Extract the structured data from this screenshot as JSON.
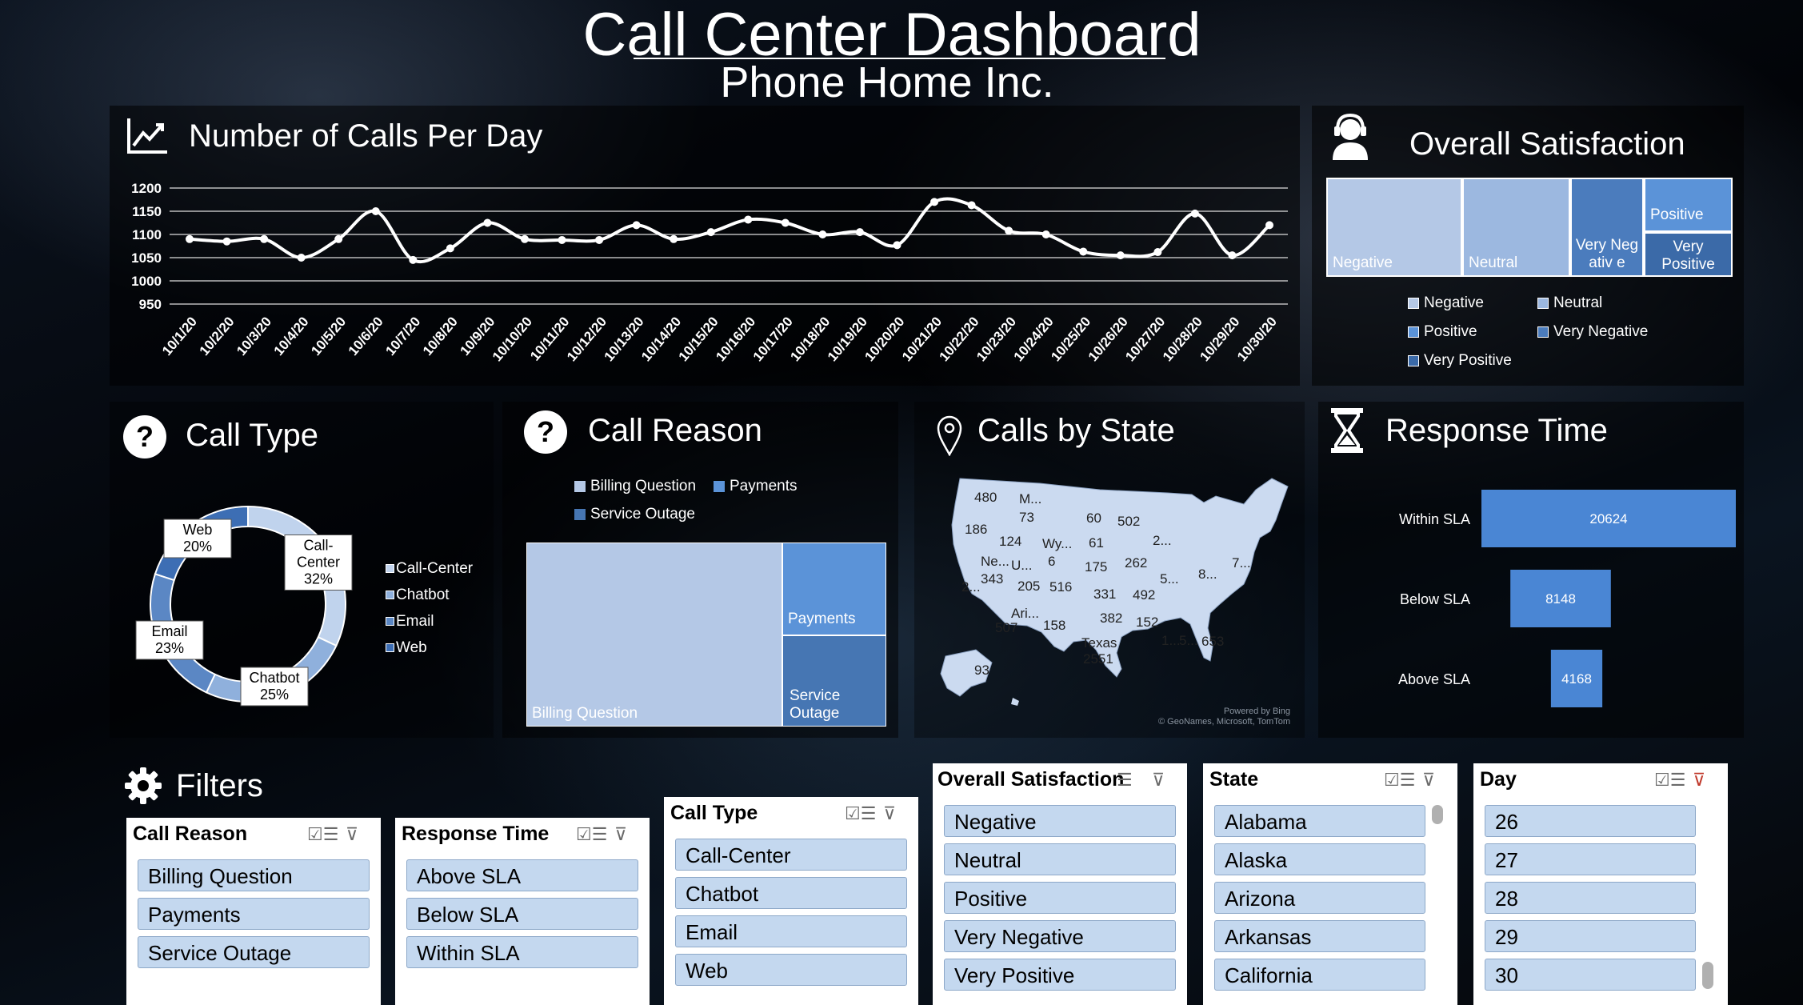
{
  "header": {
    "title": "Call Center Dashboard",
    "subtitle": "Phone Home Inc."
  },
  "calls_per_day": {
    "title": "Number of Calls Per Day",
    "icon": "line-chart-icon",
    "chart_data": {
      "type": "line",
      "yticks": [
        1200,
        1150,
        1100,
        1050,
        1000,
        950
      ],
      "ylim": [
        950,
        1200
      ],
      "grid": true,
      "x": [
        "10/1/20",
        "10/2/20",
        "10/3/20",
        "10/4/20",
        "10/5/20",
        "10/6/20",
        "10/7/20",
        "10/8/20",
        "10/9/20",
        "10/10/20",
        "10/11/20",
        "10/12/20",
        "10/13/20",
        "10/14/20",
        "10/15/20",
        "10/16/20",
        "10/17/20",
        "10/18/20",
        "10/19/20",
        "10/20/20",
        "10/21/20",
        "10/22/20",
        "10/23/20",
        "10/24/20",
        "10/25/20",
        "10/26/20",
        "10/27/20",
        "10/28/20",
        "10/29/20",
        "10/30/20"
      ],
      "values": [
        1090,
        1085,
        1090,
        1050,
        1090,
        1150,
        1045,
        1070,
        1125,
        1090,
        1088,
        1088,
        1120,
        1090,
        1105,
        1132,
        1125,
        1100,
        1105,
        1077,
        1170,
        1163,
        1108,
        1100,
        1063,
        1055,
        1062,
        1145,
        1055,
        1120
      ]
    }
  },
  "satisfaction": {
    "title": "Overall Satisfaction",
    "icon": "support-agent-icon",
    "chart_data": {
      "type": "treemap",
      "items": [
        {
          "label": "Negative",
          "color": "#b4c8e6"
        },
        {
          "label": "Neutral",
          "color": "#9cb8e0"
        },
        {
          "label": "Very Negativ e",
          "color": "#4b7cbd"
        },
        {
          "label": "Positive",
          "color": "#5b93d8"
        },
        {
          "label": "Very Positive",
          "color": "#3b6aa8"
        }
      ],
      "legend": [
        "Negative",
        "Neutral",
        "Positive",
        "Very Negative",
        "Very Positive"
      ]
    }
  },
  "call_type": {
    "title": "Call Type",
    "icon": "question-icon",
    "chart_data": {
      "type": "pie",
      "donut": true,
      "slices": [
        {
          "label": "Call-Center",
          "value": 32,
          "text": "Call-Center 32%",
          "color": "#c0d3ed"
        },
        {
          "label": "Chatbot",
          "value": 25,
          "text": "Chatbot 25%",
          "color": "#8fb0dc"
        },
        {
          "label": "Email",
          "value": 23,
          "text": "Email 23%",
          "color": "#5b87c4"
        },
        {
          "label": "Web",
          "value": 20,
          "text": "Web 20%",
          "color": "#3d6eb4"
        }
      ],
      "legend": [
        "Call-Center",
        "Chatbot",
        "Email",
        "Web"
      ]
    }
  },
  "call_reason": {
    "title": "Call Reason",
    "icon": "question-icon",
    "chart_data": {
      "type": "treemap",
      "legend": [
        "Billing Question",
        "Payments",
        "Service Outage"
      ],
      "items": [
        {
          "label": "Billing Question",
          "color": "#b4c8e6"
        },
        {
          "label": "Payments",
          "color": "#5b93d8"
        },
        {
          "label": "Service Outage",
          "color": "#4676b3"
        }
      ]
    }
  },
  "calls_by_state": {
    "title": "Calls by State",
    "icon": "map-pin-icon",
    "labels": [
      "480",
      "M...",
      "73",
      "186",
      "124",
      "Wy...",
      "6",
      "60",
      "502",
      "61",
      "2...",
      "Ne...",
      "343",
      "U...",
      "175",
      "262",
      "8...",
      "7...",
      "2...",
      "205",
      "516",
      "5...",
      "331",
      "492",
      "Ari...",
      "507",
      "158",
      "382",
      "152",
      "1...",
      "5...",
      "653",
      "Texas",
      "2551",
      "93"
    ],
    "attribution": [
      "Powered by Bing",
      "© GeoNames, Microsoft, TomTom"
    ]
  },
  "response_time": {
    "title": "Response Time",
    "icon": "hourglass-icon",
    "chart_data": {
      "type": "bar",
      "orientation": "horizontal",
      "categories": [
        "Within SLA",
        "Below SLA",
        "Above SLA"
      ],
      "values": [
        20624,
        8148,
        4168
      ],
      "color": "#4a86d4"
    }
  },
  "filters": {
    "title": "Filters",
    "icon": "gear-icon",
    "slicers": [
      {
        "title": "Call Reason",
        "items": [
          "Billing Question",
          "Payments",
          "Service Outage"
        ]
      },
      {
        "title": "Response Time",
        "items": [
          "Above SLA",
          "Below SLA",
          "Within SLA"
        ]
      },
      {
        "title": "Call Type",
        "items": [
          "Call-Center",
          "Chatbot",
          "Email",
          "Web"
        ]
      },
      {
        "title": "Overall Satisfaction",
        "items": [
          "Negative",
          "Neutral",
          "Positive",
          "Very Negative",
          "Very Positive"
        ]
      },
      {
        "title": "State",
        "items": [
          "Alabama",
          "Alaska",
          "Arizona",
          "Arkansas",
          "California"
        ]
      },
      {
        "title": "Day",
        "items": [
          "26",
          "27",
          "28",
          "29",
          "30"
        ]
      }
    ]
  }
}
